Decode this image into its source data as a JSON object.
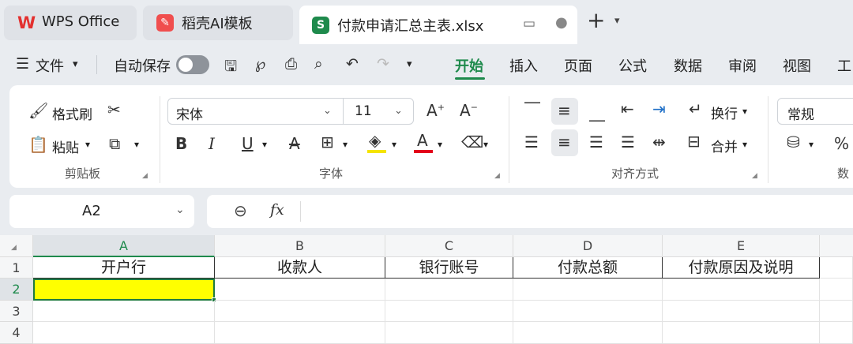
{
  "tabs": [
    {
      "label": "WPS Office",
      "icon": "wps-logo-icon"
    },
    {
      "label": "稻壳AI模板",
      "icon": "docer-icon"
    },
    {
      "label": "付款申请汇总主表.xlsx",
      "icon": "spreadsheet-icon",
      "icon_letter": "S"
    }
  ],
  "menubar": {
    "file": "文件",
    "autosave": "自动保存",
    "items": [
      "开始",
      "插入",
      "页面",
      "公式",
      "数据",
      "审阅",
      "视图",
      "工"
    ],
    "active": "开始"
  },
  "ribbon": {
    "format_painter": "格式刷",
    "paste": "粘贴",
    "clipboard_group": "剪贴板",
    "font_name": "宋体",
    "font_size": "11",
    "font_group": "字体",
    "wrap": "换行",
    "merge": "合并",
    "align_group": "对齐方式",
    "number_format": "常规",
    "number_group": "数",
    "percent": "%"
  },
  "formula_bar": {
    "cell_ref": "A2",
    "fx": "fx",
    "value": ""
  },
  "sheet": {
    "columns": [
      "A",
      "B",
      "C",
      "D",
      "E"
    ],
    "rows": [
      "1",
      "2",
      "3",
      "4"
    ],
    "header_row": [
      "开户行",
      "收款人",
      "银行账号",
      "付款总额",
      "付款原因及说明"
    ],
    "selected_cell": "A2",
    "selected_fill": "#ffff00"
  },
  "colors": {
    "accent_green": "#1e8a4c",
    "selection_border": "#1f7a3f"
  }
}
